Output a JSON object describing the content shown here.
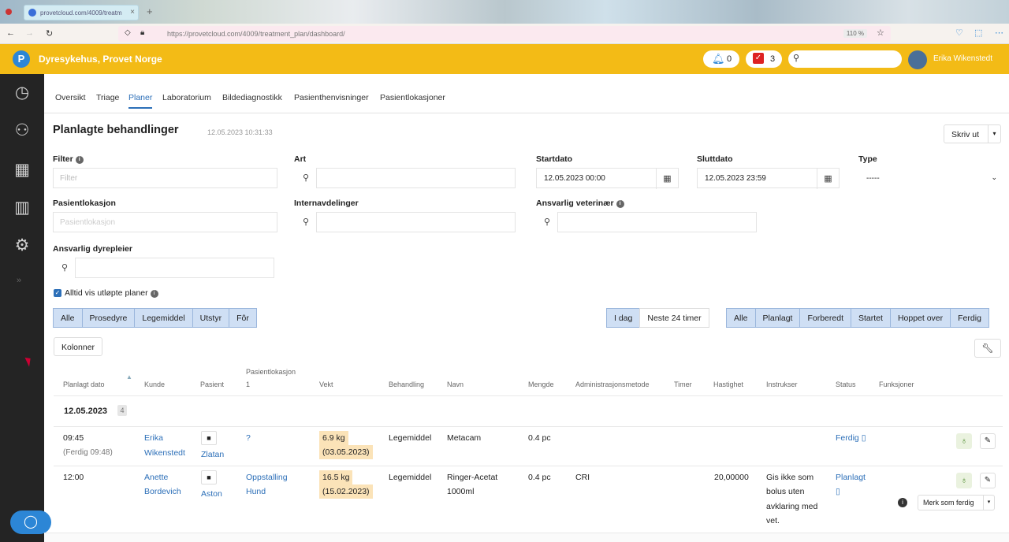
{
  "browser": {
    "tab_title": "provetcloud.com/4009/treatm",
    "url": "https://provetcloud.com/4009/treatment_plan/dashboard/",
    "zoom": "110 %"
  },
  "header": {
    "clinic": "Dyresykehus, Provet Norge",
    "notifications": "0",
    "tasks": "3",
    "user": "Erika Wikenstedt"
  },
  "tabs": [
    "Oversikt",
    "Triage",
    "Planer",
    "Laboratorium",
    "Bildediagnostikk",
    "Pasienthenvisninger",
    "Pasientlokasjoner"
  ],
  "page": {
    "title": "Planlagte behandlinger",
    "timestamp": "12.05.2023 10:31:33",
    "print_label": "Skriv ut"
  },
  "filters": {
    "filter_label": "Filter",
    "filter_placeholder": "Filter",
    "art_label": "Art",
    "start_label": "Startdato",
    "start_value": "12.05.2023 00:00",
    "end_label": "Sluttdato",
    "end_value": "12.05.2023 23:59",
    "type_label": "Type",
    "type_value": "-----",
    "location_label": "Pasientlokasjon",
    "location_placeholder": "Pasientlokasjon",
    "dept_label": "Internavdelinger",
    "vet_label": "Ansvarlig veterinær",
    "nurse_label": "Ansvarlig dyrepleier",
    "expired_label": "Alltid vis utløpte planer"
  },
  "category_buttons": [
    "Alle",
    "Prosedyre",
    "Legemiddel",
    "Utstyr",
    "Fôr"
  ],
  "time_buttons": [
    "I dag",
    "Neste 24 timer"
  ],
  "status_buttons": [
    "Alle",
    "Planlagt",
    "Forberedt",
    "Startet",
    "Hoppet over",
    "Ferdig"
  ],
  "columns_label": "Kolonner",
  "table": {
    "headers": [
      "Planlagt dato",
      "Kunde",
      "Pasient",
      "Pasientlokasjon",
      "1",
      "Vekt",
      "Behandling",
      "Navn",
      "Mengde",
      "Administrasjonsmetode",
      "Timer",
      "Hastighet",
      "Instrukser",
      "Status",
      "Funksjoner"
    ],
    "group_date": "12.05.2023",
    "group_count": "4",
    "rows": [
      {
        "time": "09:45",
        "time_note": "(Ferdig 09:48)",
        "client_first": "Erika",
        "client_last": "Wikenstedt",
        "patient": "Zlatan",
        "location": "?",
        "weight": "6.9 kg",
        "weight_date": "(03.05.2023)",
        "treatment": "Legemiddel",
        "name": "Metacam",
        "amount": "0.4 pc",
        "method": "",
        "timer": "",
        "rate": "",
        "instructions": "",
        "status": "Ferdig"
      },
      {
        "time": "12:00",
        "time_note": "",
        "client_first": "Anette",
        "client_last": "Bordevich",
        "patient": "Aston",
        "location": "Oppstalling",
        "location2": "Hund",
        "weight": "16.5 kg",
        "weight_date": "(15.02.2023)",
        "treatment": "Legemiddel",
        "name": "Ringer-Acetat",
        "name2": "1000ml",
        "amount": "0.4 pc",
        "method": "CRI",
        "timer": "",
        "rate": "20,00000",
        "instructions": [
          "Gis ikke som",
          "bolus uten",
          "avklaring med",
          "vet."
        ],
        "status": "Planlagt",
        "action": "Merk som ferdig"
      }
    ]
  },
  "colors": {
    "header": "#f3bb16",
    "sidebar": "#242424",
    "link": "#2c6fb8",
    "weight_bg": "#fbe3b8",
    "button_bg": "#cfdff4"
  }
}
